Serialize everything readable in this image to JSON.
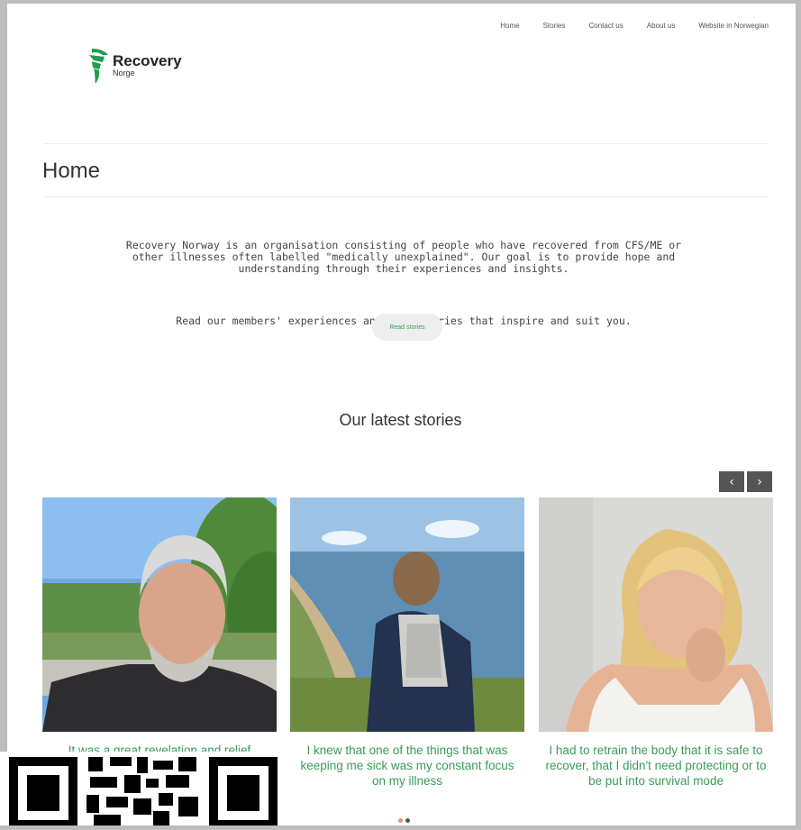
{
  "nav": {
    "items": [
      "Home",
      "Stories",
      "Contact us",
      "About us",
      "Website in Norwegian"
    ]
  },
  "logo": {
    "name": "Recovery",
    "sub": "Norge",
    "color": "#1e9e4a"
  },
  "page": {
    "title": "Home",
    "intro": "Recovery Norway is an organisation consisting of people who have recovered from CFS/ME or other illnesses often labelled \"medically unexplained\". Our goal is to provide hope and understanding through their experiences and insights.",
    "intro2": "Read our members' experiences and find stories that inspire and suit you.",
    "read_button": "Read stories"
  },
  "stories": {
    "title": "Our latest stories",
    "prev_icon": "‹",
    "next_icon": "›",
    "cards": [
      {
        "caption": "It was a great revelation and relief"
      },
      {
        "caption": "I knew that one of the things that was keeping me sick was my constant focus on my illness"
      },
      {
        "caption": "I had to retrain the body that it is safe to recover, that I didn't need protecting or to be put into survival mode"
      }
    ]
  },
  "colors": {
    "accent": "#3a9a5a",
    "dot_active": "#e98c6a",
    "dot_inactive": "#555555"
  }
}
